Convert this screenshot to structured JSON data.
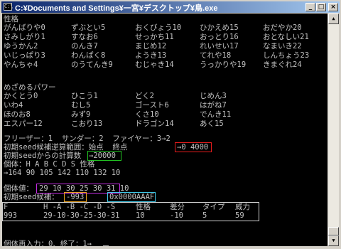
{
  "window": {
    "title": "C:¥Documents and Settings¥一宮¥デスクトップ¥鳥.exe",
    "controls": {
      "minimize": "_",
      "maximize": "□",
      "close": "×"
    }
  },
  "colors": {
    "console_bg": "#000000",
    "console_fg": "#c0c0c0",
    "box_red": "#e81c1c",
    "box_green": "#22c222",
    "box_magenta": "#c22ce0",
    "box_orange": "#e8a020",
    "box_cyan": "#40c8e8"
  },
  "nature": {
    "header": "性格",
    "rows": [
      [
        "がんばりや0",
        "ずぶとい5",
        "おくびょう10",
        "ひかえめ15",
        "おだやか20"
      ],
      [
        "さみしがり1",
        "すなお6",
        "せっかち11",
        "おっとり16",
        "おとなしい21"
      ],
      [
        "ゆうかん2",
        "のんき7",
        "まじめ12",
        "れいせい17",
        "なまいき22"
      ],
      [
        "いじっぱり3",
        "わんぱく8",
        "ようき13",
        "てれや18",
        "しんちょう23"
      ],
      [
        "やんちゃ4",
        "のうてんき9",
        "むじゃき14",
        "うっかりや19",
        "きまぐれ24"
      ]
    ]
  },
  "hidden_power": {
    "header": "めざめるパワー",
    "rows": [
      [
        "かくとう0",
        "ひこう1",
        "どく2",
        "じめん3"
      ],
      [
        "いわ4",
        "むし5",
        "ゴースト6",
        "はがね7"
      ],
      [
        "ほのお8",
        "みず9",
        "くさ10",
        "でんき11"
      ],
      [
        "エスパー12",
        "こおり13",
        "ドラゴン14",
        "あく15"
      ]
    ]
  },
  "log": {
    "birds": "フリーザー：1  サンダー：2  ファイヤー：3→2",
    "range_label": "初期seed候補逆算範囲：始点  終点",
    "range_value": "→0 4000",
    "count_label": "初期seedからの計算数",
    "count_value": "→20000",
    "iv_prompt": "個体：H A B C D S 性格",
    "iv_input": "→164 90 105 142 110 132 10",
    "iv_label": "個体値：",
    "iv_value": "29 10 30 25 30 31 10",
    "seed_label": "初期seed候補：",
    "seed_value": "-993",
    "seed_hex": "0x0000AAAF",
    "result_header": [
      "F",
      "H -A -B -C -D -S",
      "性格",
      "差分",
      "タイプ",
      "威力"
    ],
    "result_row": [
      "993",
      "29-10-30-25-30-31",
      "10",
      "-10",
      "5",
      "59"
    ],
    "restart_prompt": "個体再入力：0、終了：1→"
  }
}
